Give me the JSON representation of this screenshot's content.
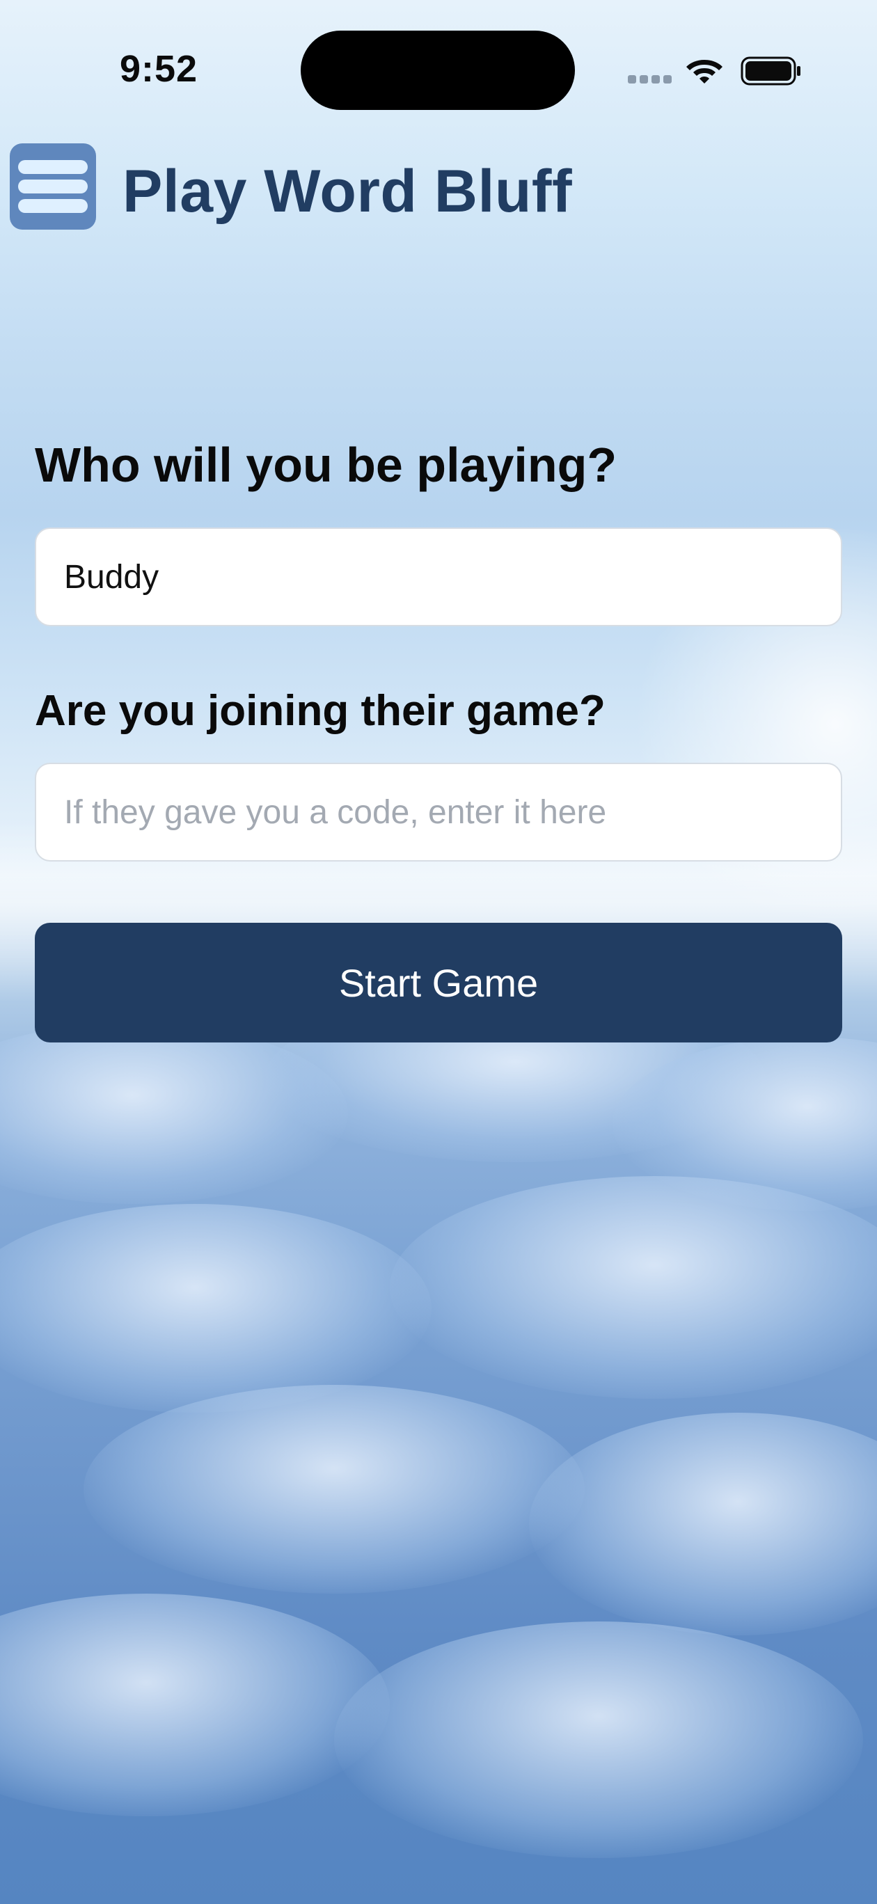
{
  "status_bar": {
    "time": "9:52",
    "signal_icon": "signal-dots-icon",
    "wifi_icon": "wifi-icon",
    "battery_icon": "battery-icon"
  },
  "header": {
    "menu_icon": "hamburger-menu-icon",
    "title": "Play Word Bluff"
  },
  "form": {
    "opponent_label": "Who will you be playing?",
    "opponent_value": "Buddy",
    "join_label": "Are you joining their game?",
    "code_value": "",
    "code_placeholder": "If they gave you a code, enter it here",
    "start_button_label": "Start Game"
  },
  "colors": {
    "brand_navy": "#213d62",
    "menu_button_bg": "#5f87bd",
    "menu_lines": "#dff0ff"
  }
}
